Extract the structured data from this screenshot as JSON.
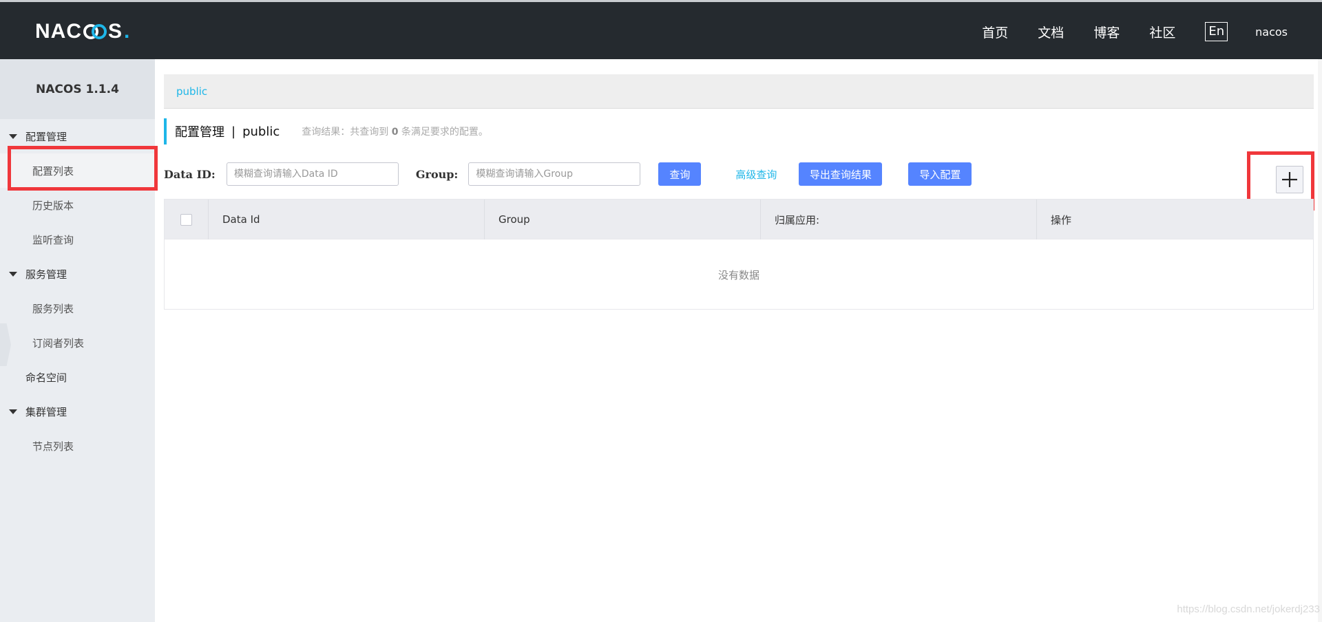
{
  "header": {
    "logo_main": "NAC",
    "logo_tail": "S",
    "logo_dot": ".",
    "nav": [
      "首页",
      "文档",
      "博客",
      "社区"
    ],
    "lang": "En",
    "user": "nacos"
  },
  "sidebar": {
    "title": "NACOS 1.1.4",
    "groups": [
      {
        "label": "配置管理",
        "items": [
          "配置列表",
          "历史版本",
          "监听查询"
        ]
      },
      {
        "label": "服务管理",
        "items": [
          "服务列表",
          "订阅者列表"
        ]
      },
      {
        "label": "命名空间"
      },
      {
        "label": "集群管理",
        "items": [
          "节点列表"
        ]
      }
    ]
  },
  "breadcrumb": "public",
  "title": {
    "main": "配置管理",
    "sep": "|",
    "namespace": "public",
    "result_prefix": "查询结果：共查询到",
    "result_count": "0",
    "result_suffix": "条满足要求的配置。"
  },
  "filters": {
    "data_id_label": "Data ID:",
    "data_id_placeholder": "模糊查询请输入Data ID",
    "group_label": "Group:",
    "group_placeholder": "模糊查询请输入Group",
    "query_button": "查询",
    "advanced_link": "高级查询",
    "export_button": "导出查询结果",
    "import_button": "导入配置"
  },
  "table": {
    "columns": [
      "Data Id",
      "Group",
      "归属应用:",
      "操作"
    ],
    "empty_text": "没有数据"
  },
  "watermark": "https://blog.csdn.net/jokerdj233"
}
